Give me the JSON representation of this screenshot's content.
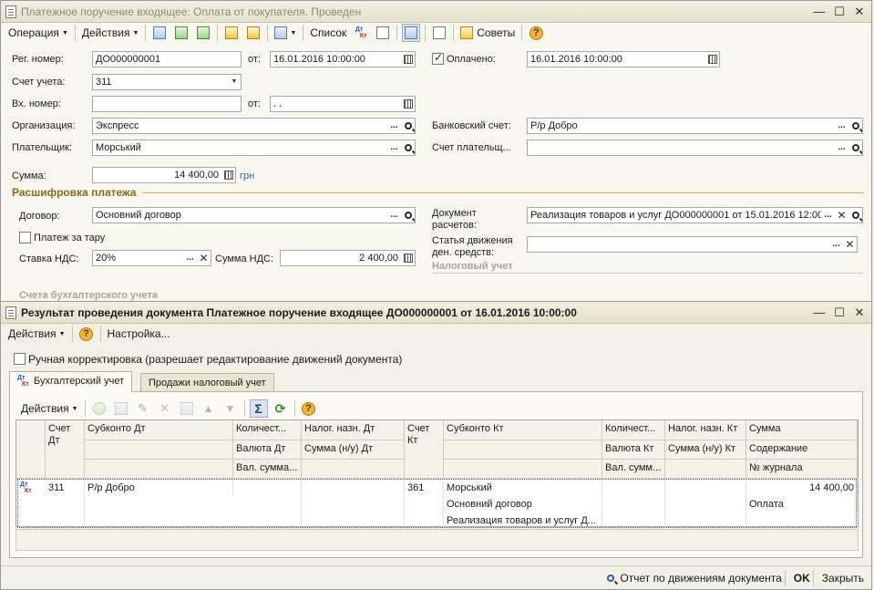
{
  "doc_window": {
    "title": "Платежное поручение входящее: Оплата от покупателя. Проведен",
    "toolbar": {
      "operation": "Операция",
      "actions": "Действия",
      "list": "Список",
      "advice": "Советы"
    },
    "fields": {
      "reg_number_label": "Рег. номер:",
      "reg_number": "ДО000000001",
      "from_label": "от:",
      "reg_date": "16.01.2016 10:00:00",
      "paid_label": "Оплачено:",
      "paid_checked": true,
      "paid_date": "16.01.2016 10:00:00",
      "account_label": "Счет учета:",
      "account": "311",
      "in_number_label": "Вх. номер:",
      "in_number": "",
      "in_from_label": "от:",
      "in_date": " .  .",
      "org_label": "Организация:",
      "org": "Экспресс",
      "bank_account_label": "Банковский счет:",
      "bank_account": "Р/р Добро",
      "payer_label": "Плательщик:",
      "payer": "Морський",
      "payer_account_label": "Счет плательщ...",
      "payer_account": "",
      "sum_label": "Сумма:",
      "sum": "14 400,00",
      "currency": "грн"
    },
    "breakdown": {
      "title": "Расшифровка платежа",
      "contract_label": "Договор:",
      "contract": "Основний договор",
      "tare_label": "Платеж за тару",
      "tare_checked": false,
      "vat_rate_label": "Ставка НДС:",
      "vat_rate": "20%",
      "vat_sum_label": "Сумма НДС:",
      "vat_sum": "2 400,00",
      "settlement_doc_label_1": "Документ",
      "settlement_doc_label_2": "расчетов:",
      "settlement_doc": "Реализация товаров и услуг ДО000000001 от 15.01.2016 12:00",
      "cash_flow_label_1": "Статья движения",
      "cash_flow_label_2": "ден. средств:",
      "cash_flow": "",
      "tax_section": "Налоговый учет",
      "accounts_section": "Счета бухгалтерского учета"
    }
  },
  "result_window": {
    "title": "Результат проведения документа Платежное поручение входящее ДО000000001 от 16.01.2016 10:00:00",
    "toolbar": {
      "actions": "Действия",
      "settings": "Настройка..."
    },
    "manual_correction_label": "Ручная корректировка (разрешает редактирование движений документа)",
    "manual_correction_checked": false,
    "tabs": [
      {
        "label": "Бухгалтерский учет",
        "active": true
      },
      {
        "label": "Продажи налоговый учет",
        "active": false
      }
    ],
    "grid_toolbar": {
      "actions": "Действия"
    },
    "grid": {
      "headers": {
        "account_dt": "Счет Дт",
        "subconto_dt": "Субконто Дт",
        "qty_dt": "Количест...",
        "tax_dt": "Налог. назн. Дт",
        "currency_dt": "Валюта Дт",
        "sum_nu_dt": "Сумма (н/у) Дт",
        "cur_sum_dt": "Вал. сумма...",
        "account_kt": "Счет Кт",
        "subconto_kt": "Субконто Кт",
        "qty_kt": "Количест...",
        "tax_kt": "Налог. назн. Кт",
        "currency_kt": "Валюта Кт",
        "sum_nu_kt": "Сумма (н/у) Кт",
        "cur_sum_kt": "Вал. сумм...",
        "sum": "Сумма",
        "content": "Содержание",
        "journal_no": "№ журнала"
      },
      "row": {
        "account_dt": "311",
        "subconto_dt_1": "Р/р Добро",
        "account_kt": "361",
        "subconto_kt_1": "Морський",
        "subconto_kt_2": "Основний договор",
        "subconto_kt_3": "Реализация товаров и услуг Д...",
        "sum": "14 400,00",
        "content": "Оплата"
      }
    },
    "status": {
      "report": "Отчет по движениям документа",
      "ok": "OK",
      "close": "Закрыть"
    }
  }
}
